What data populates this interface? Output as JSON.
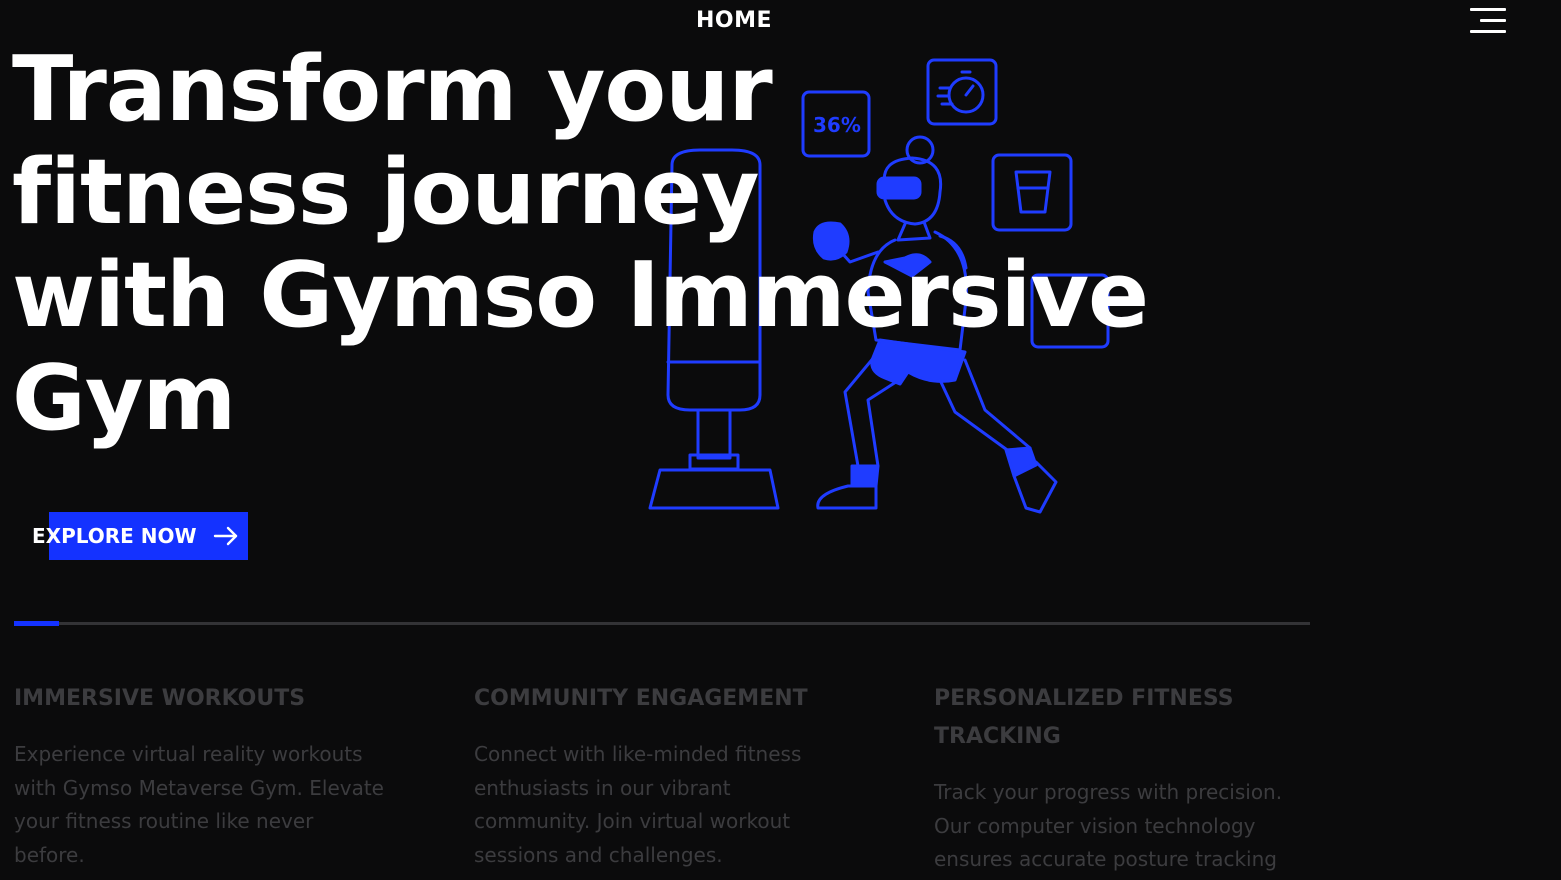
{
  "header": {
    "brand_label": "HOME",
    "brand_icon": "soundwave-logo-icon",
    "menu_icon": "hamburger-menu-icon"
  },
  "hero": {
    "title_lines": [
      "Transform your",
      "fitness journey",
      "with Gymso Immersive",
      "Gym"
    ],
    "illustration_badge": "36%",
    "cta_label": "EXPLORE NOW",
    "cta_icon": "arrow-right-icon"
  },
  "slider": {
    "progress": 0.035
  },
  "features": [
    {
      "title": "IMMERSIVE WORKOUTS",
      "text": "Experience virtual reality workouts with Gymso Metaverse Gym. Elevate your fitness routine like never before."
    },
    {
      "title": "COMMUNITY ENGAGEMENT",
      "text": "Connect with like-minded fitness enthusiasts in our vibrant community. Join virtual workout sessions and challenges."
    },
    {
      "title": "PERSONALIZED FITNESS TRACKING",
      "text": "Track your progress with precision. Our computer vision technology ensures accurate posture tracking"
    }
  ],
  "colors": {
    "background": "#0b0b0c",
    "accent": "#1432ff",
    "illustration_stroke": "#1f3cff",
    "muted_text": "#3c3c3f"
  }
}
